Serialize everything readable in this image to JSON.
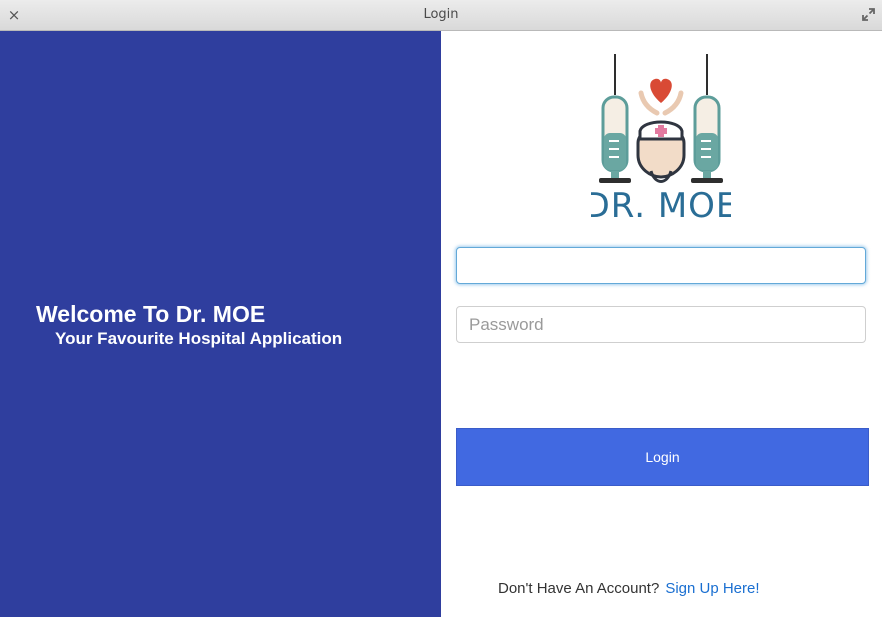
{
  "window": {
    "title": "Login",
    "close_glyph": "×",
    "close_icon": "close-icon",
    "maximize_icon": "maximize-icon"
  },
  "left": {
    "welcome": "Welcome To Dr. MOE",
    "tagline": "Your Favourite Hospital Application",
    "background": "#2f3e9e"
  },
  "logo": {
    "text": "DR. MOE",
    "icon": "doctor-syringe-logo"
  },
  "form": {
    "username_value": "",
    "username_placeholder": "",
    "password_placeholder": "Password",
    "login_label": "Login",
    "button_color": "#4169e1"
  },
  "footer": {
    "prompt": "Don't Have An Account?",
    "signup_link": "Sign Up Here!",
    "link_color": "#1a6fd1"
  }
}
